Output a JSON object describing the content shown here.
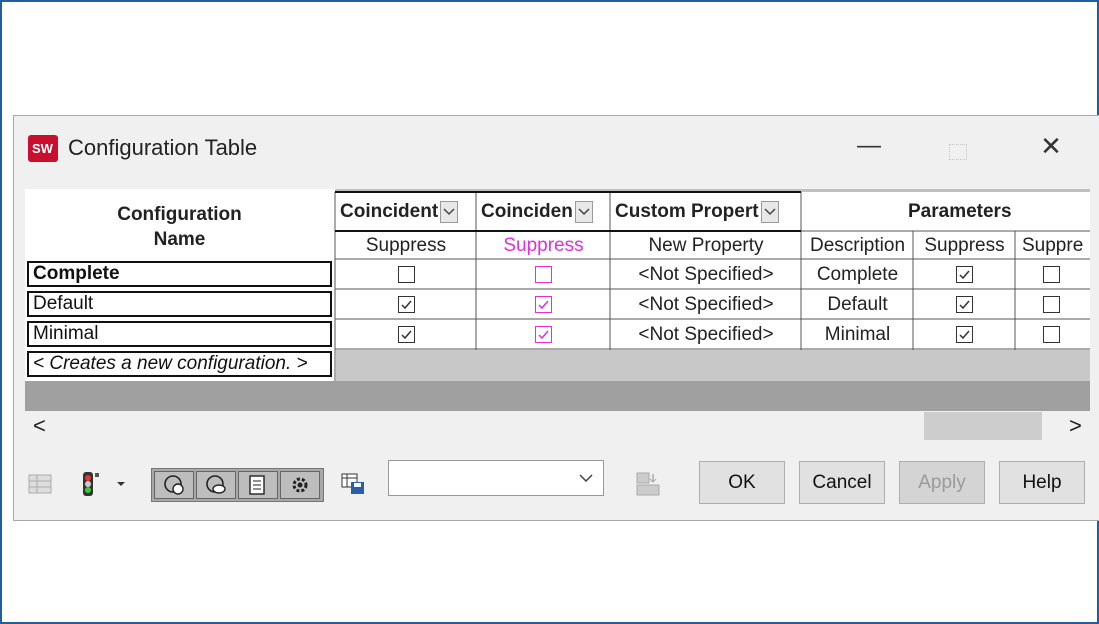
{
  "window": {
    "title": "Configuration Table",
    "minimize_glyph": "—",
    "close_glyph": "✕"
  },
  "table": {
    "config_header": "Configuration Name",
    "columns": [
      {
        "group": "Coincident",
        "sub": "Suppress",
        "color": "#222222"
      },
      {
        "group": "Coinciden",
        "sub": "Suppress",
        "color": "#e02ee0"
      },
      {
        "group": "Custom Propert",
        "sub": "New Property",
        "color": "#222222"
      },
      {
        "group": "Parameters",
        "sub": "Description",
        "color": "#222222"
      },
      {
        "group": "Parameters",
        "sub": "Suppress",
        "color": "#222222"
      },
      {
        "group": "Parameters",
        "sub": "Suppre",
        "color": "#222222"
      }
    ],
    "parameters_label": "Parameters",
    "rows": [
      {
        "name": "Complete",
        "bold": true,
        "c1": false,
        "c2": false,
        "prop": "<Not Specified>",
        "desc": "Complete",
        "c5": true,
        "c6": false
      },
      {
        "name": "Default",
        "bold": false,
        "c1": true,
        "c2": true,
        "prop": "<Not Specified>",
        "desc": "Default",
        "c5": true,
        "c6": false
      },
      {
        "name": "Minimal",
        "bold": false,
        "c1": true,
        "c2": true,
        "prop": "<Not Specified>",
        "desc": "Minimal",
        "c5": true,
        "c6": false
      }
    ],
    "new_config_row": "< Creates a new configuration. >"
  },
  "scrollbar": {
    "left_arrow": "<",
    "right_arrow": ">"
  },
  "toolbar": {
    "icons": [
      "table-grid-icon",
      "traffic-light-icon",
      "dropdown-arrow-icon",
      "show-hide-features-icon",
      "visibility-icon",
      "list-view-icon",
      "settings-gear-icon",
      "save-table-icon",
      "table-columns-icon"
    ],
    "select_value": "",
    "buttons": {
      "ok": "OK",
      "cancel": "Cancel",
      "apply": "Apply",
      "help": "Help"
    }
  },
  "colors": {
    "accent_pink": "#e02ee0",
    "frame_blue": "#1f5fa0",
    "status_grey": "#a0a0a0"
  }
}
